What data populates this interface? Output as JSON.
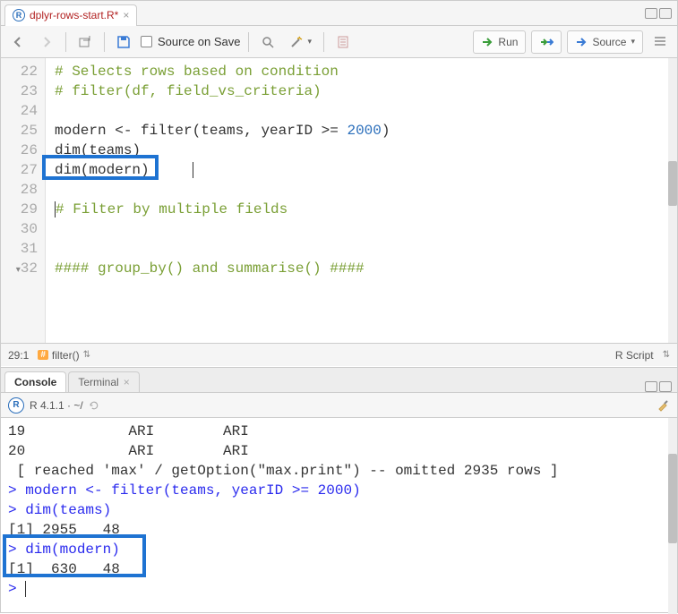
{
  "editor": {
    "tab_filename": "dplyr-rows-start.R*",
    "toolbar": {
      "source_on_save_label": "Source on Save",
      "run_label": "Run",
      "source_label": "Source"
    },
    "gutter": [
      "22",
      "23",
      "24",
      "25",
      "26",
      "27",
      "28",
      "29",
      "30",
      "31",
      "32"
    ],
    "code_lines": {
      "l22": "# Selects rows based on condition",
      "l23": "# filter(df, field_vs_criteria)",
      "l24": "",
      "l25_a": "modern ",
      "l25_b": "<-",
      "l25_c": " filter(teams, yearID ",
      "l25_d": ">=",
      "l25_e": " ",
      "l25_f": "2000",
      "l25_g": ")",
      "l26": "dim(teams)",
      "l27": "dim(modern)",
      "l28": "",
      "l29": "# Filter by multiple fields",
      "l30": "",
      "l31": "",
      "l32": "#### group_by() and summarise() ####"
    },
    "status": {
      "pos": "29:1",
      "breadcrumb": "filter()",
      "lang": "R Script"
    }
  },
  "console": {
    "tabs": {
      "console": "Console",
      "terminal": "Terminal"
    },
    "toolbar_label": "R 4.1.1 · ~/",
    "lines": {
      "l1": "19            ARI        ARI",
      "l2": "20            ARI        ARI",
      "l3": " [ reached 'max' / getOption(\"max.print\") -- omitted 2935 rows ]",
      "l4": "> modern <- filter(teams, yearID >= 2000)",
      "l5": "> dim(teams)",
      "l6": "[1] 2955   48",
      "l7": "> dim(modern)",
      "l8": "[1]  630   48",
      "l9": "> "
    }
  }
}
